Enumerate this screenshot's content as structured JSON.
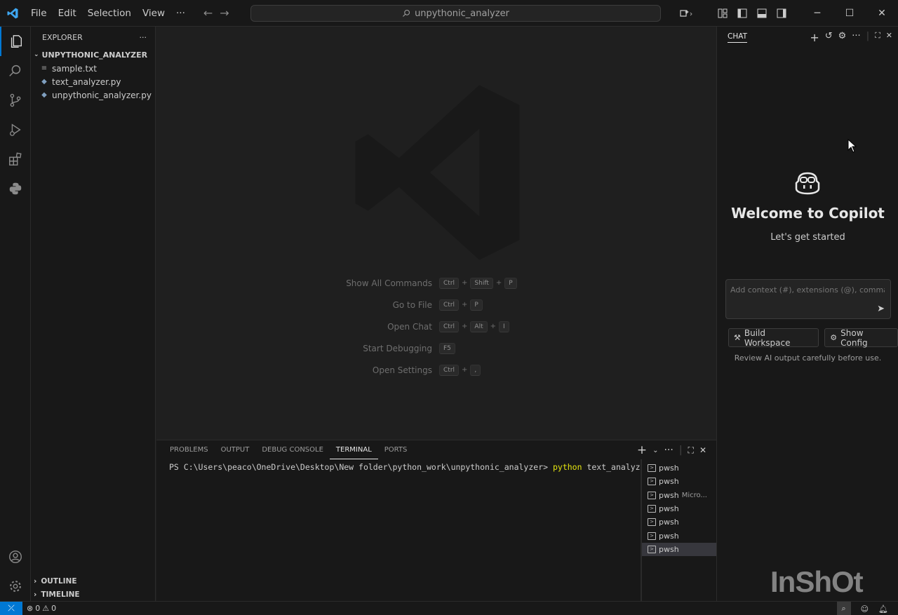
{
  "titlebar": {
    "menu": [
      "File",
      "Edit",
      "Selection",
      "View"
    ],
    "more": "···",
    "search_text": "unpythonic_analyzer"
  },
  "sidebar": {
    "title": "EXPLORER",
    "folder": "UNPYTHONIC_ANALYZER",
    "files": [
      {
        "name": "sample.txt",
        "icon": "text-file-icon"
      },
      {
        "name": "text_analyzer.py",
        "icon": "python-file-icon"
      },
      {
        "name": "unpythonic_analyzer.py",
        "icon": "python-file-icon"
      }
    ],
    "outline": "OUTLINE",
    "timeline": "TIMELINE"
  },
  "editor": {
    "shortcuts": [
      {
        "label": "Show All Commands",
        "keys": [
          "Ctrl",
          "Shift",
          "P"
        ]
      },
      {
        "label": "Go to File",
        "keys": [
          "Ctrl",
          "P"
        ]
      },
      {
        "label": "Open Chat",
        "keys": [
          "Ctrl",
          "Alt",
          "I"
        ]
      },
      {
        "label": "Start Debugging",
        "keys": [
          "F5"
        ]
      },
      {
        "label": "Open Settings",
        "keys": [
          "Ctrl",
          ","
        ]
      }
    ]
  },
  "panel": {
    "tabs": [
      "PROBLEMS",
      "OUTPUT",
      "DEBUG CONSOLE",
      "TERMINAL",
      "PORTS"
    ],
    "active_tab": "TERMINAL",
    "prompt": "PS C:\\Users\\peaco\\OneDrive\\Desktop\\New folder\\python_work\\unpythonic_analyzer> ",
    "command": "python",
    "args": " text_analyzer.py",
    "terminals": [
      {
        "name": "pwsh",
        "sub": ""
      },
      {
        "name": "pwsh",
        "sub": ""
      },
      {
        "name": "pwsh",
        "sub": "Micro..."
      },
      {
        "name": "pwsh",
        "sub": ""
      },
      {
        "name": "pwsh",
        "sub": ""
      },
      {
        "name": "pwsh",
        "sub": ""
      },
      {
        "name": "pwsh",
        "sub": ""
      }
    ]
  },
  "chat": {
    "title": "CHAT",
    "welcome": "Welcome to Copilot",
    "subtitle": "Let's get started",
    "input_placeholder": "Add context (#), extensions (@), commands",
    "buttons": [
      "Build Workspace",
      "Show Config"
    ],
    "review_note": "Review AI output carefully before use."
  },
  "statusbar": {
    "errors": "0",
    "warnings": "0"
  },
  "overlay": {
    "watermark_text": "InShOt"
  },
  "colors": {
    "accent": "#0078d4",
    "terminal_command": "#e5e510"
  }
}
